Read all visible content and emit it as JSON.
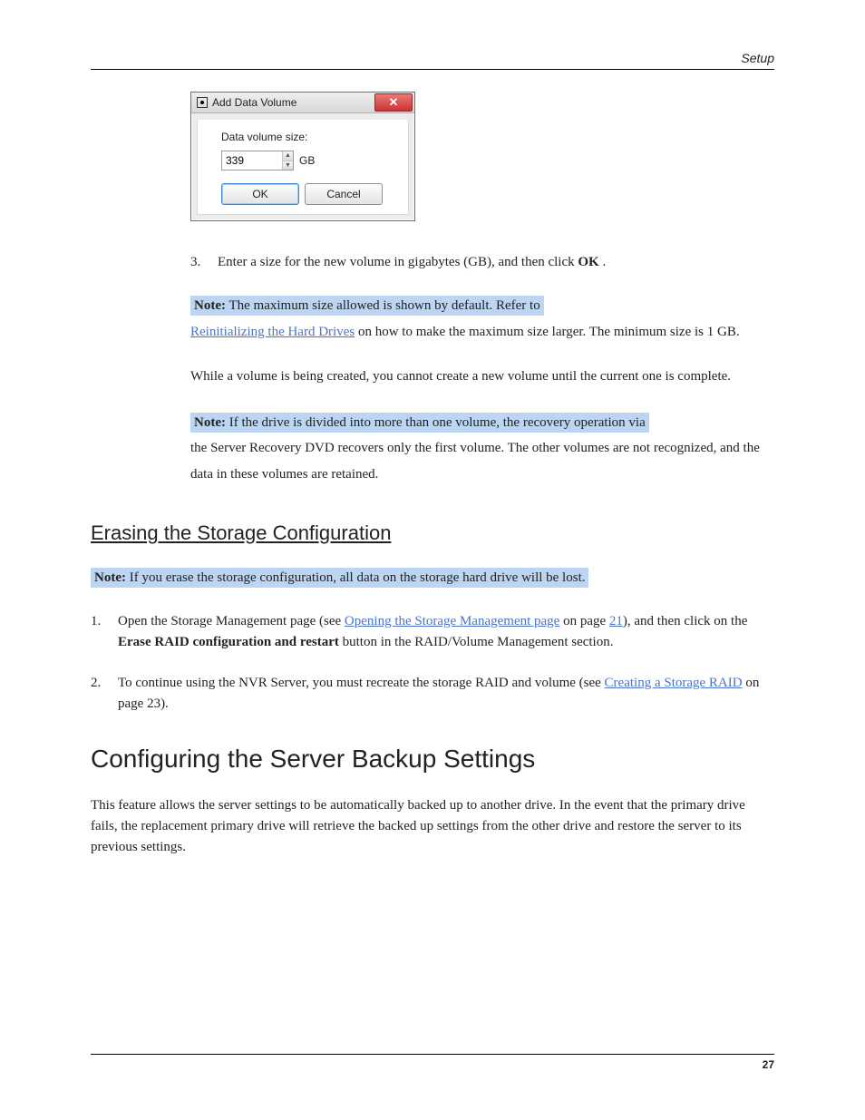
{
  "header": {
    "section": "Setup"
  },
  "dialog": {
    "title": "Add Data Volume",
    "label": "Data volume size:",
    "value": "339",
    "unit": "GB",
    "ok": "OK",
    "cancel": "Cancel"
  },
  "step3": {
    "text_a": "Enter a size for the new volume in gigabytes (GB), and then click ",
    "ok": "OK",
    "text_b": "."
  },
  "note1": {
    "lead": "Note:",
    "part1": " The maximum size allowed is shown by default. Refer to ",
    "link": "Reinitializing the Hard Drives",
    "part2": " on how to make the maximum size larger. The minimum size is 1 GB."
  },
  "warn": "While a volume is being created, you cannot create a new volume until the current one is complete.",
  "note2": {
    "lead": "Note:",
    "body": " If the drive is divided into more than one volume, the recovery operation via the Server Recovery DVD recovers only the first volume. The other volumes are not recognized, and the data in these volumes are retained."
  },
  "section1": {
    "heading": "Erasing the Storage Configuration",
    "note_lead": "Note:",
    "note_body": " If you erase the storage configuration, all data on the storage hard drive will be lost.",
    "step1_a": "Open the Storage Management page (see ",
    "step1_link1": "Opening the Storage Management page",
    "step1_b": " on page ",
    "step1_link2": "21",
    "step1_c": "), and then click on the ",
    "step1_bold": "Erase RAID configuration and restart",
    "step1_d": " button in the RAID/Volume Management section.",
    "step2_a": "To continue using the NVR Server, you must recreate the storage RAID and volume (see ",
    "step2_link": "Creating a Storage RAID",
    "step2_b": " on page 23)."
  },
  "section2": {
    "heading": "Configuring the Server Backup Settings",
    "para": "This feature allows the server settings to be automatically backed up to another drive. In the event that the primary drive fails, the replacement primary drive will retrieve the backed up settings from the other drive and restore the server to its previous settings."
  },
  "footer": {
    "page": "27"
  }
}
